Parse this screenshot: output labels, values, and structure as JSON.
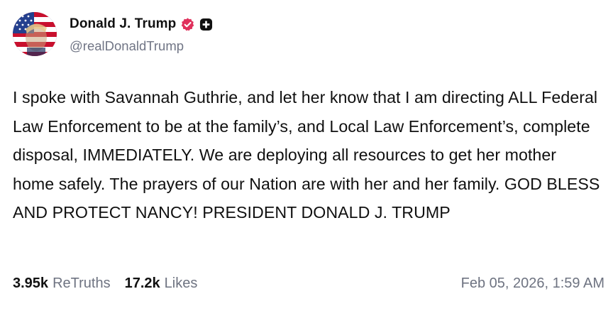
{
  "author": {
    "display_name": "Donald J. Trump",
    "handle": "@realDonaldTrump",
    "verified_icon": "verified-badge-icon",
    "plus_icon": "plus-badge-icon"
  },
  "post": {
    "text": "I spoke with Savannah Guthrie, and let her know that I am directing ALL Federal Law Enforcement to be at the family’s, and Local Law Enforcement’s, complete disposal, IMMEDIATELY. We are deploying all resources to get her mother home safely. The prayers of our Nation are with her and her family. GOD BLESS AND PROTECT NANCY! PRESIDENT DONALD J. TRUMP"
  },
  "stats": {
    "retruths_count": "3.95k",
    "retruths_label": "ReTruths",
    "likes_count": "17.2k",
    "likes_label": "Likes"
  },
  "timestamp": "Feb 05, 2026, 1:59 AM",
  "colors": {
    "verified_badge": "#e0315c",
    "muted_text": "#6e7381",
    "body_text": "#101010"
  }
}
